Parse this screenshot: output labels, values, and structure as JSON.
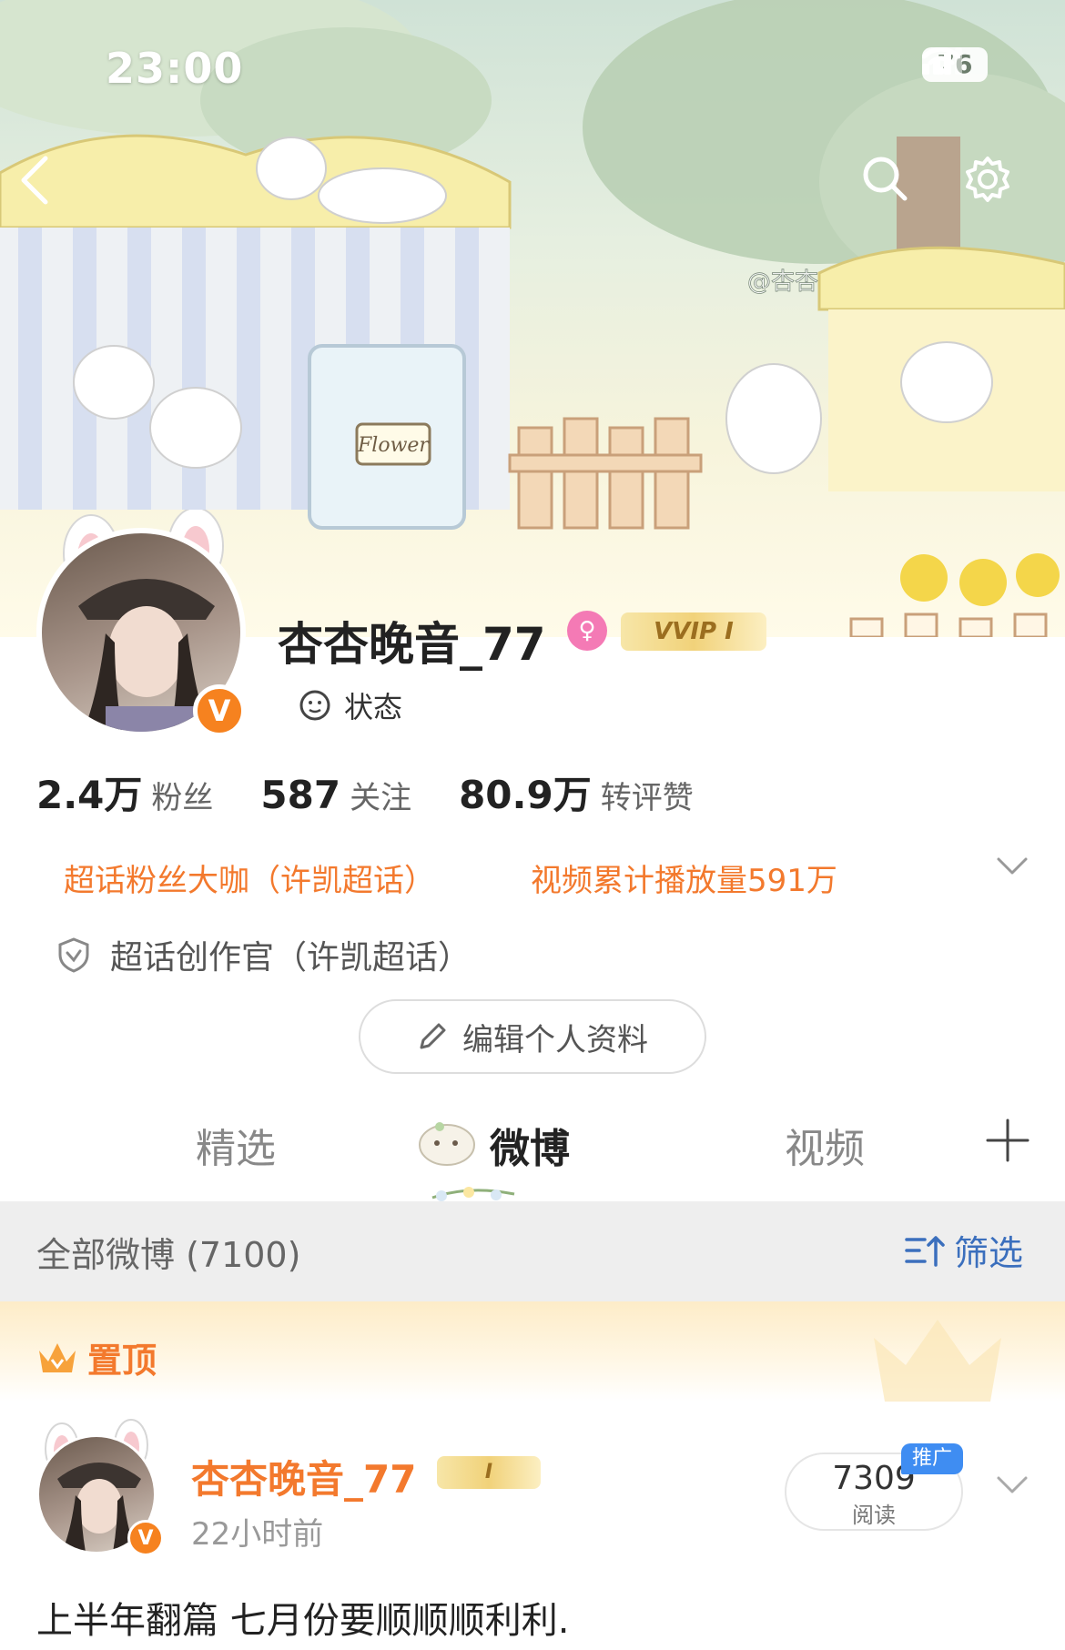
{
  "status_bar": {
    "time": "23:00",
    "battery": "76"
  },
  "banner": {
    "sign_text": "Flower",
    "watermark": "@杏杏"
  },
  "profile": {
    "username": "杏杏晚音_77",
    "vip_label": "VVIP Ⅰ",
    "verified_mark": "V",
    "gender_icon": "female-icon",
    "state_label": "状态"
  },
  "stats": [
    {
      "value": "2.4万",
      "label": "粉丝"
    },
    {
      "value": "587",
      "label": "关注"
    },
    {
      "value": "80.9万",
      "label": "转评赞"
    }
  ],
  "tags": {
    "tag1": "超话粉丝大咖（许凯超话）",
    "tag2": "视频累计播放量591万",
    "official": "超话创作官（许凯超话）"
  },
  "edit_profile_label": "编辑个人资料",
  "tabs": [
    {
      "label": "精选",
      "active": false
    },
    {
      "label": "微博",
      "active": true
    },
    {
      "label": "视频",
      "active": false
    }
  ],
  "filter": {
    "title": "全部微博 (7100)",
    "button": "筛选"
  },
  "pinned": {
    "label": "置顶",
    "author": "杏杏晚音_77",
    "author_badge": "Ⅰ",
    "time": "22小时前",
    "reads_value": "7309",
    "reads_label": "阅读",
    "promo_label": "推广",
    "text": "上半年翻篇 七月份要顺顺顺利利."
  },
  "colors": {
    "accent_orange": "#f3792d",
    "link_blue": "#3b6fbd",
    "verified_orange": "#f6821f"
  }
}
